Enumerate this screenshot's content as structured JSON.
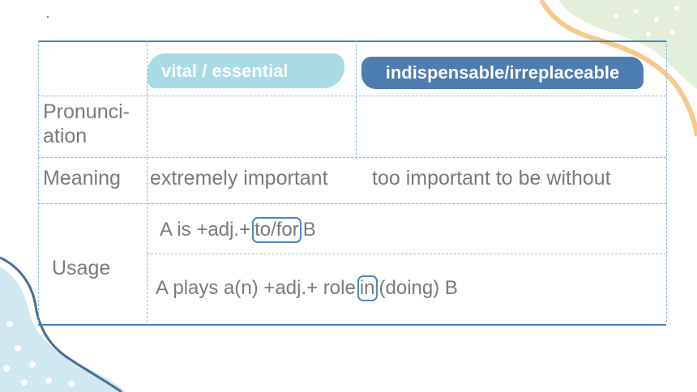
{
  "header": {
    "col1": "vital / essential",
    "col2": "indispensable/irreplaceable"
  },
  "rows": {
    "pronunciation": {
      "label": "Pronunci-ation"
    },
    "meaning": {
      "label": "Meaning",
      "col1": "extremely important",
      "col2": "too important to be without"
    },
    "usage": {
      "label": "Usage",
      "line1": {
        "before": "A is +adj.+",
        "highlight": "to/for",
        "after": "B"
      },
      "line2": {
        "before": "A plays a(n) +adj.+ role",
        "highlight": "in",
        "after": "(doing) B"
      }
    }
  },
  "colors": {
    "border": "#3f83c4",
    "pill_vital": "#a7dbe6",
    "pill_indispensable": "#4d7cb0",
    "highlight_box": "#4c86c8",
    "text": "#7a7a7a"
  }
}
